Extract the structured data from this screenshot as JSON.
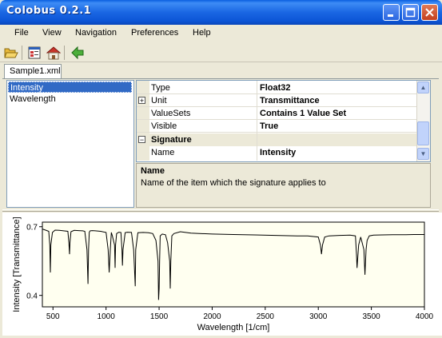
{
  "window": {
    "title": "Colobus 0.2.1"
  },
  "menu": [
    "File",
    "View",
    "Navigation",
    "Preferences",
    "Help"
  ],
  "toolbar": {
    "icons": [
      "open-folder-icon",
      "properties-icon",
      "home-icon",
      "back-arrow-icon"
    ]
  },
  "tab": {
    "label": "Sample1.xml"
  },
  "left_list": {
    "items": [
      "Intensity",
      "Wavelength"
    ],
    "selected": "Intensity"
  },
  "properties": {
    "rows": [
      {
        "name": "Type",
        "value": "Float32",
        "expander": ""
      },
      {
        "name": "Unit",
        "value": "Transmittance",
        "expander": "+"
      },
      {
        "name": "ValueSets",
        "value": "Contains 1 Value Set",
        "expander": ""
      },
      {
        "name": "Visible",
        "value": "True",
        "expander": ""
      }
    ],
    "category": {
      "label": "Signature",
      "expander": "−"
    },
    "selected_row": {
      "name": "Name",
      "value": "Intensity"
    }
  },
  "description": {
    "title": "Name",
    "text": "Name of the item which the signature applies to"
  },
  "colors": {
    "selection": "#316ac5",
    "plot_bg": "#fffff0",
    "titlebar": "#0a5fe0"
  },
  "chart_data": {
    "type": "line",
    "xlabel": "Wavelength [1/cm]",
    "ylabel": "Intensity [Transmittance]",
    "xlim": [
      400,
      4000
    ],
    "ylim": [
      0.35,
      0.72
    ],
    "xticks": [
      "500",
      "1000",
      "1500",
      "2000",
      "2500",
      "3000",
      "3500",
      "4000"
    ],
    "yticks": [
      "0.4",
      "0.7"
    ],
    "grid": false,
    "series": [
      {
        "x": [
          400,
          430,
          460,
          470,
          475,
          480,
          495,
          520,
          560,
          600,
          640,
          650,
          656,
          660,
          670,
          700,
          740,
          780,
          800,
          820,
          830,
          835,
          842,
          850,
          870,
          900,
          950,
          1000,
          1020,
          1030,
          1040,
          1050,
          1060,
          1080,
          1085,
          1090,
          1100,
          1120,
          1140,
          1150,
          1155,
          1160,
          1180,
          1200,
          1240,
          1260,
          1275,
          1280,
          1300,
          1350,
          1400,
          1440,
          1470,
          1490,
          1495,
          1500,
          1505,
          1510,
          1530,
          1560,
          1580,
          1600,
          1605,
          1610,
          1620,
          1640,
          1700,
          1750,
          1800,
          2000,
          2200,
          2400,
          2600,
          2800,
          2900,
          3000,
          3020,
          3030,
          3040,
          3060,
          3100,
          3200,
          3300,
          3350,
          3360,
          3365,
          3380,
          3400,
          3430,
          3440,
          3450,
          3460,
          3480,
          3520,
          3600,
          3700,
          3800,
          3900,
          4000
        ],
        "y": [
          0.69,
          0.685,
          0.68,
          0.62,
          0.5,
          0.62,
          0.675,
          0.685,
          0.684,
          0.682,
          0.68,
          0.63,
          0.58,
          0.63,
          0.678,
          0.684,
          0.683,
          0.682,
          0.68,
          0.6,
          0.45,
          0.6,
          0.676,
          0.682,
          0.683,
          0.682,
          0.68,
          0.675,
          0.6,
          0.5,
          0.6,
          0.675,
          0.66,
          0.62,
          0.52,
          0.62,
          0.67,
          0.676,
          0.675,
          0.6,
          0.53,
          0.6,
          0.674,
          0.676,
          0.675,
          0.6,
          0.44,
          0.6,
          0.674,
          0.675,
          0.674,
          0.67,
          0.64,
          0.55,
          0.38,
          0.43,
          0.55,
          0.66,
          0.668,
          0.665,
          0.63,
          0.55,
          0.43,
          0.55,
          0.66,
          0.67,
          0.678,
          0.675,
          0.672,
          0.668,
          0.666,
          0.664,
          0.662,
          0.66,
          0.66,
          0.655,
          0.62,
          0.58,
          0.62,
          0.655,
          0.66,
          0.662,
          0.663,
          0.66,
          0.58,
          0.52,
          0.62,
          0.655,
          0.6,
          0.49,
          0.6,
          0.64,
          0.66,
          0.663,
          0.664,
          0.665,
          0.665,
          0.666,
          0.666
        ]
      }
    ]
  }
}
